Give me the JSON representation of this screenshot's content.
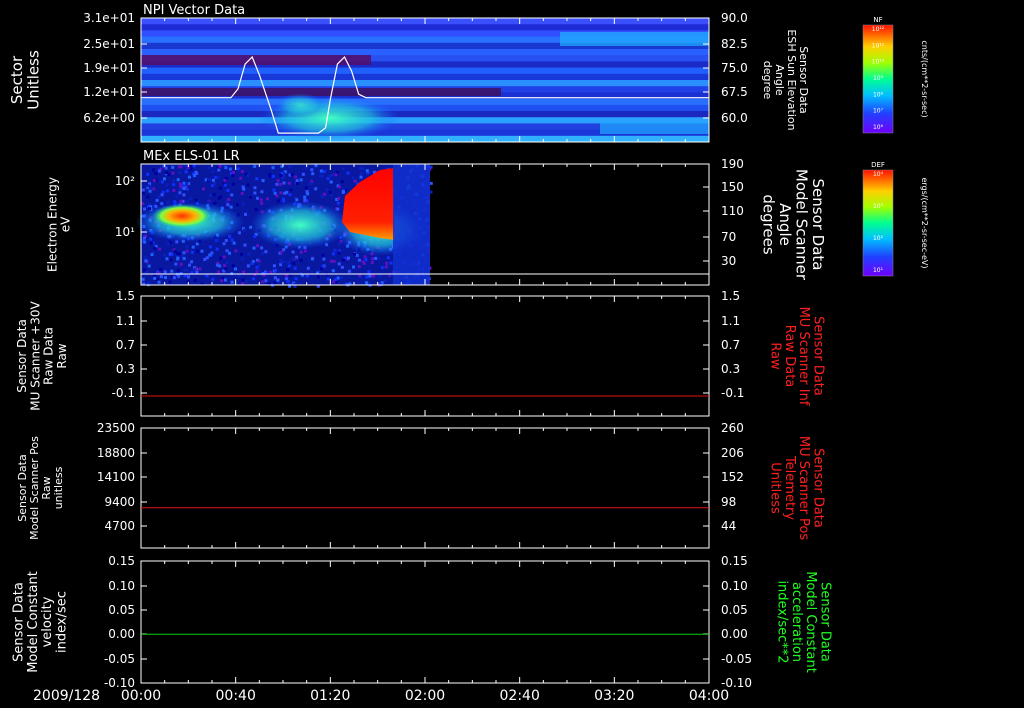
{
  "colors": {
    "background": "#000000",
    "axes": "#ffffff",
    "red_trace": "#e01010",
    "green_trace": "#10d010",
    "red_label": "#ff2020",
    "green_label": "#20ff20"
  },
  "chart_data": [
    {
      "type": "heatmap",
      "title": "NPI Vector Data",
      "ylabel": [
        "Sector",
        "Unitless"
      ],
      "yticks": [
        "3.1e+01",
        "2.5e+01",
        "1.9e+01",
        "1.2e+01",
        "6.2e+00"
      ],
      "ylim": [
        0,
        31
      ],
      "y2label": [
        "Sensor Data",
        "ESH Sun Elevation",
        "Angle",
        "degree"
      ],
      "y2ticks": [
        "90.0",
        "82.5",
        "75.0",
        "67.5",
        "60.0"
      ],
      "y2lim": [
        55,
        90
      ],
      "overlay_line": {
        "color": "#ffffff",
        "x_min": [
          0,
          38,
          41,
          44,
          47,
          50,
          55,
          58,
          62,
          66,
          69,
          72,
          75,
          78,
          80,
          83,
          86,
          89,
          92,
          95,
          100,
          240
        ],
        "y": [
          67.5,
          67.5,
          70,
          77,
          79,
          74,
          64,
          57.5,
          57.5,
          57.5,
          57.5,
          57.5,
          57.5,
          59,
          67,
          77,
          79,
          75,
          68.5,
          67.5,
          67.5,
          67.5
        ]
      },
      "colorbar": {
        "label": "NF",
        "unit": "cnts/(cm**2-sr-sec)",
        "ticks": [
          "10¹²",
          "10¹¹",
          "10¹⁰",
          "10⁹",
          "10⁸",
          "10⁷",
          "10⁶"
        ]
      }
    },
    {
      "type": "heatmap",
      "title": "MEx ELS-01 LR",
      "ylabel": [
        "Electron Energy",
        "eV"
      ],
      "yticks": [
        "10²",
        "10¹"
      ],
      "yscale": "log",
      "y2label": [
        "Sensor Data",
        "Model Scanner",
        "Angle",
        "degrees"
      ],
      "y2ticks": [
        "190",
        "150",
        "110",
        "70",
        "30"
      ],
      "y2lim": [
        0,
        190
      ],
      "overlay_line": {
        "color": "#ffffff",
        "value": 0
      },
      "data_end": "01:50",
      "colorbar": {
        "label": "DEF",
        "unit": "ergs/(cm**2-sr-sec-eV)",
        "ticks": [
          "10⁴",
          "10³",
          "10²",
          "10¹"
        ]
      }
    },
    {
      "type": "line",
      "ylabel": [
        "Sensor Data",
        "MU Scanner +30V",
        "Raw Data",
        "Raw"
      ],
      "yticks": [
        "1.5",
        "1.1",
        "0.7",
        "0.3",
        "-0.1"
      ],
      "ylim": [
        -0.3,
        1.5
      ],
      "y2label": [
        "Sensor Data",
        "MU Scanner Inf",
        "Raw Data",
        "Raw"
      ],
      "y2ticks": [
        "1.5",
        "1.1",
        "0.7",
        "0.3",
        "-0.1"
      ],
      "series": [
        {
          "color": "#e01010",
          "value": 0.0
        }
      ]
    },
    {
      "type": "line",
      "ylabel": [
        "Sensor Data",
        "Model Scanner Pos",
        "Raw",
        "unitless"
      ],
      "yticks": [
        "23500",
        "18800",
        "14100",
        "9400",
        "4700"
      ],
      "ylim": [
        0,
        23500
      ],
      "y2label": [
        "Sensor Data",
        "MU Scanner Pos",
        "Telemetry",
        "Unitless"
      ],
      "y2ticks": [
        "260",
        "206",
        "152",
        "98",
        "44"
      ],
      "series": [
        {
          "color": "#e01010",
          "value": 7900
        }
      ]
    },
    {
      "type": "line",
      "ylabel": [
        "Sensor Data",
        "Model Constant",
        "velocity",
        "index/sec"
      ],
      "yticks": [
        "0.15",
        "0.10",
        "0.05",
        "0.00",
        "-0.05",
        "-0.10"
      ],
      "ylim": [
        -0.1,
        0.15
      ],
      "y2label": [
        "Sensor Data",
        "Model Constant",
        "acceleration",
        "index/sec**2"
      ],
      "y2ticks": [
        "0.15",
        "0.10",
        "0.05",
        "0.00",
        "-0.05",
        "-0.10"
      ],
      "series": [
        {
          "color": "#10d010",
          "value": 0.0
        }
      ]
    }
  ],
  "xaxis": {
    "date": "2009/128",
    "ticks": [
      "00:00",
      "00:40",
      "01:20",
      "02:00",
      "02:40",
      "03:20",
      "04:00"
    ],
    "range_min": [
      0,
      240
    ]
  }
}
